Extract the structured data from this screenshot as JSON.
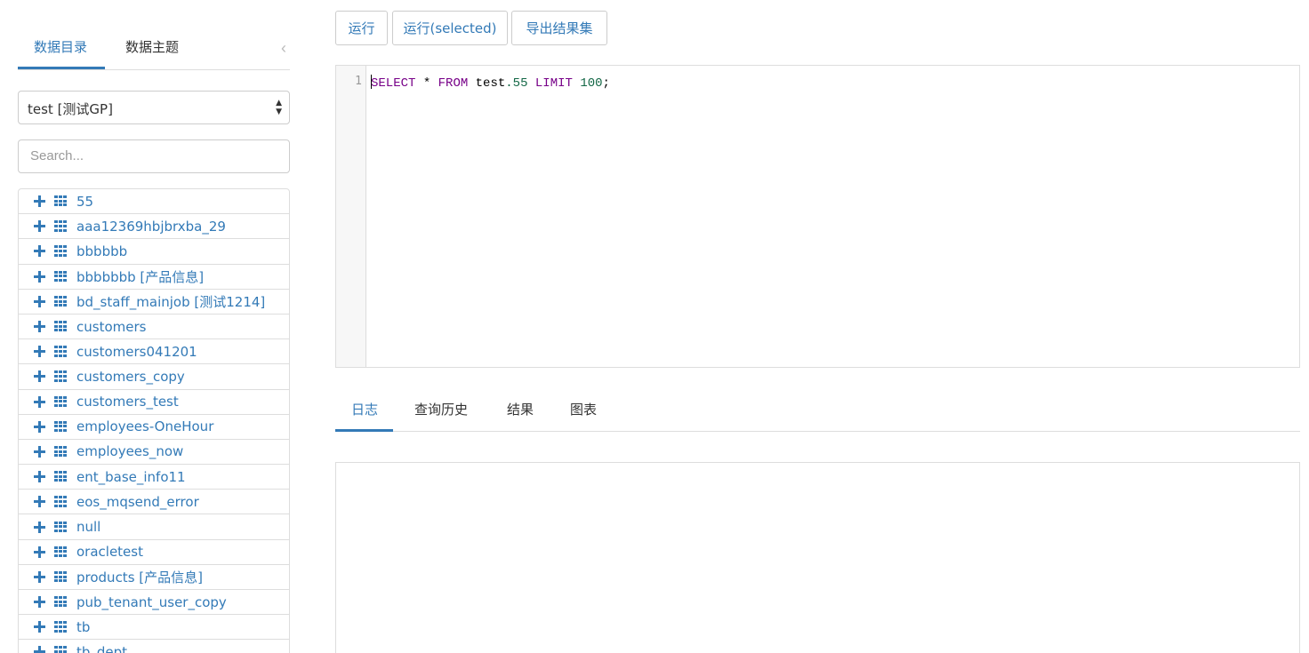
{
  "sidebar": {
    "tabs": [
      "数据目录",
      "数据主题"
    ],
    "active_tab": 0,
    "datasource_select": "test [测试GP]",
    "search_placeholder": "Search...",
    "tables": [
      "55",
      "aaa12369hbjbrxba_29",
      "bbbbbb",
      "bbbbbbb [产品信息]",
      "bd_staff_mainjob [测试1214]",
      "customers",
      "customers041201",
      "customers_copy",
      "customers_test",
      "employees-OneHour",
      "employees_now",
      "ent_base_info11",
      "eos_mqsend_error",
      "null",
      "oracletest",
      "products [产品信息]",
      "pub_tenant_user_copy",
      "tb",
      "tb_dept"
    ]
  },
  "toolbar": {
    "run": "运行",
    "run_selected": "运行(selected)",
    "export": "导出结果集"
  },
  "editor": {
    "line_number": "1",
    "sql": {
      "k1": "SELECT",
      "t1": " * ",
      "k2": "FROM",
      "t2": " test",
      "n1": ".55",
      "t3": " ",
      "k3": "LIMIT",
      "t4": " ",
      "n2": "100",
      "t5": ";"
    }
  },
  "result_tabs": [
    "日志",
    "查询历史",
    "结果",
    "图表"
  ],
  "active_result_tab": 0,
  "colors": {
    "accent": "#337ab7",
    "keyword": "#770088",
    "number": "#116644"
  }
}
